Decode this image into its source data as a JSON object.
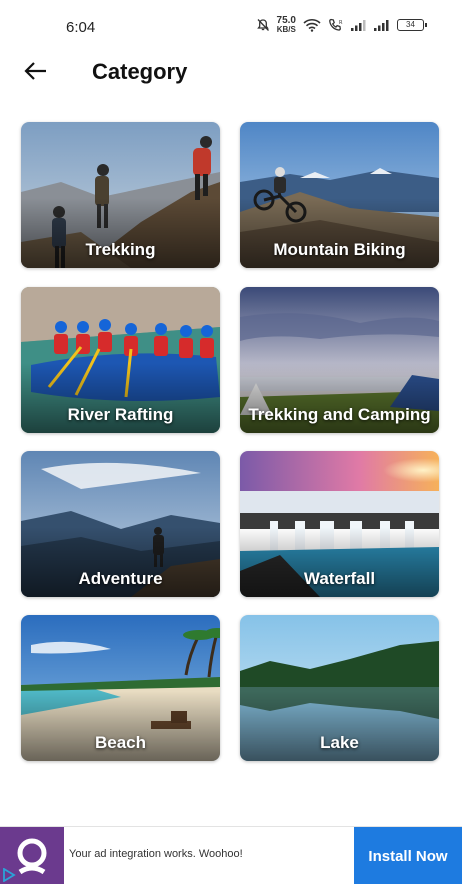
{
  "status_bar": {
    "time": "6:04",
    "net_speed_value": "75.0",
    "net_speed_unit": "KB/S",
    "battery_level": "34"
  },
  "header": {
    "back_icon": "arrow-left-icon",
    "title": "Category"
  },
  "categories": [
    {
      "label": "Trekking",
      "image": "trekking-photo"
    },
    {
      "label": "Mountain Biking",
      "image": "mountain-biking-photo"
    },
    {
      "label": "River Rafting",
      "image": "river-rafting-photo"
    },
    {
      "label": "Trekking and Camping",
      "image": "camping-photo"
    },
    {
      "label": "Adventure",
      "image": "adventure-photo"
    },
    {
      "label": "Waterfall",
      "image": "waterfall-photo"
    },
    {
      "label": "Beach",
      "image": "beach-photo"
    },
    {
      "label": "Lake",
      "image": "lake-photo"
    }
  ],
  "ad": {
    "text": "Your ad integration works. Woohoo!",
    "button_label": "Install Now",
    "brand_color": "#6b3a8e",
    "button_color": "#1e7be0"
  }
}
